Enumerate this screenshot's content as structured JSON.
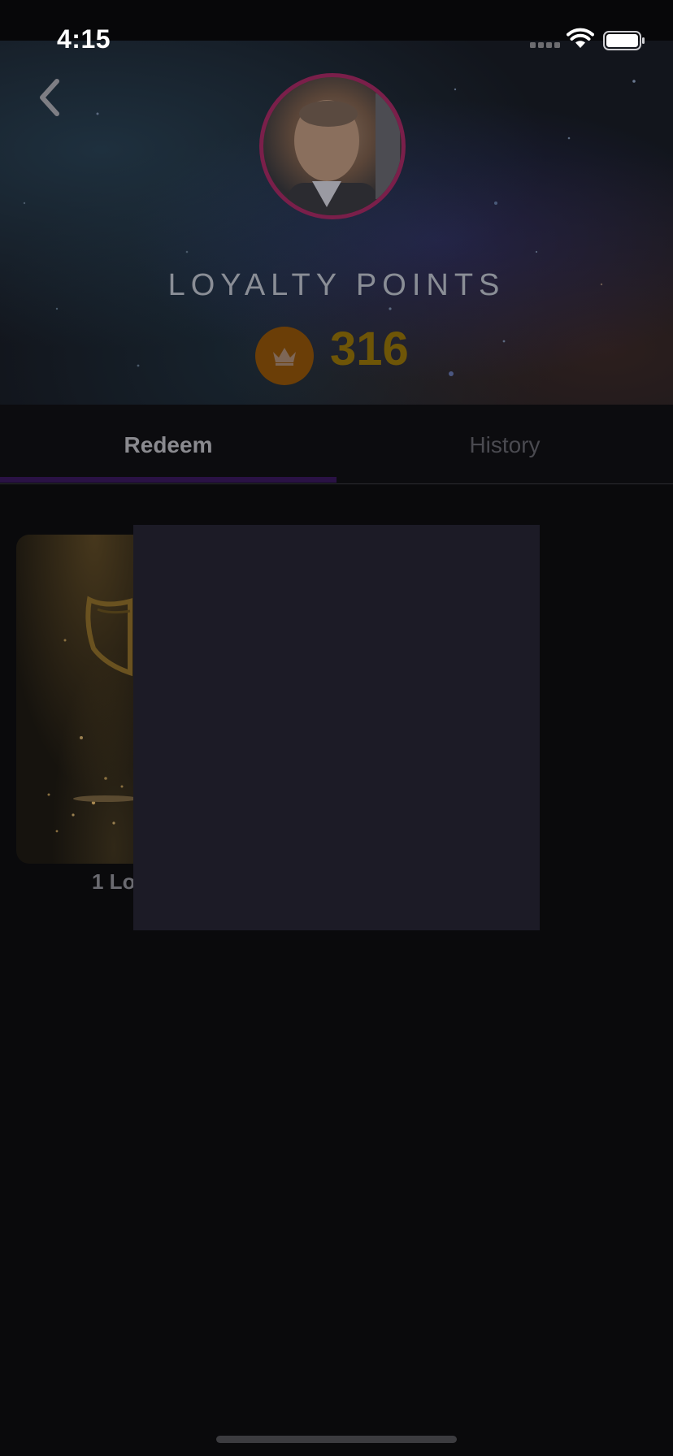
{
  "status_bar": {
    "time": "4:15",
    "icons": [
      "cellular-signal-icon",
      "wifi-icon",
      "battery-icon"
    ]
  },
  "header": {
    "back_icon": "chevron-left-icon",
    "avatar_alt": "profile photo",
    "title": "LOYALTY POINTS",
    "points_icon": "crown-icon",
    "points_value": "316"
  },
  "tabs": [
    {
      "label": "Redeem",
      "active": true
    },
    {
      "label": "History",
      "active": false
    }
  ],
  "rewards": [
    {
      "label": "1 Lo",
      "image": "shield-badge-image"
    }
  ],
  "colors": {
    "accent_purple": "#2a1245",
    "avatar_border": "#7a1f4a",
    "crown_badge": "#6b3e07",
    "points_text": "#6e5507",
    "overlay_panel": "#1c1b26",
    "background": "#0a0a0c"
  }
}
